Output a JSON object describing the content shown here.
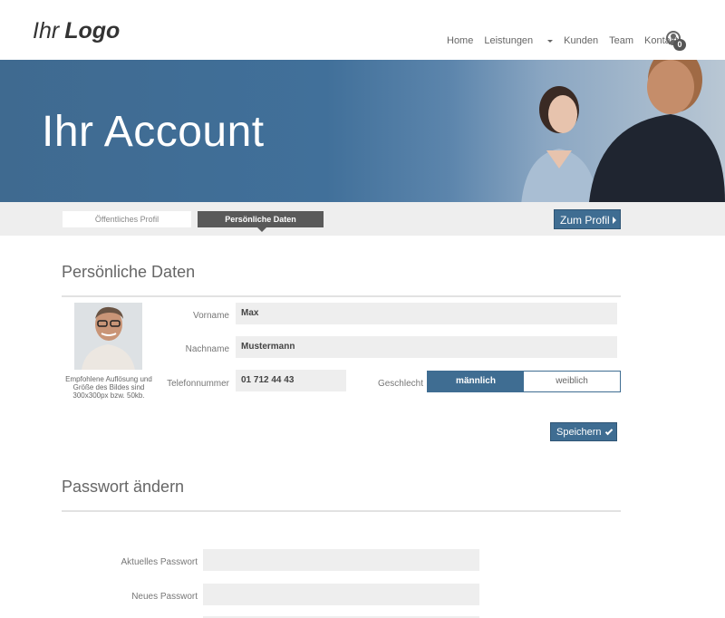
{
  "header": {
    "logo_light": "Ihr",
    "logo_bold": "Logo",
    "nav": [
      "Home",
      "Leistungen",
      "Kunden",
      "Team",
      "Kontakt"
    ],
    "badge_count": "0"
  },
  "hero": {
    "title": "Ihr Account"
  },
  "tabs": {
    "public": "Öffentliches Profil",
    "personal": "Persönliche Daten",
    "profile_button": "Zum Profil"
  },
  "personal": {
    "title": "Persönliche Daten",
    "avatar_hint": "Empfohlene Auflösung und Größe des Bildes sind 300x300px bzw. 50kb.",
    "first_name_label": "Vorname",
    "first_name_value": "Max",
    "last_name_label": "Nachname",
    "last_name_value": "Mustermann",
    "phone_label": "Telefonnummer",
    "phone_value": "01 712 44 43",
    "gender_label": "Geschlecht",
    "gender_options": [
      "männlich",
      "weiblich"
    ],
    "gender_selected": "männlich",
    "save_button": "Speichern"
  },
  "password": {
    "title": "Passwort ändern",
    "current_label": "Aktuelles Passwort",
    "new_label": "Neues Passwort"
  },
  "colors": {
    "accent": "#3f6d92",
    "tab_active": "#5a5a5a"
  }
}
